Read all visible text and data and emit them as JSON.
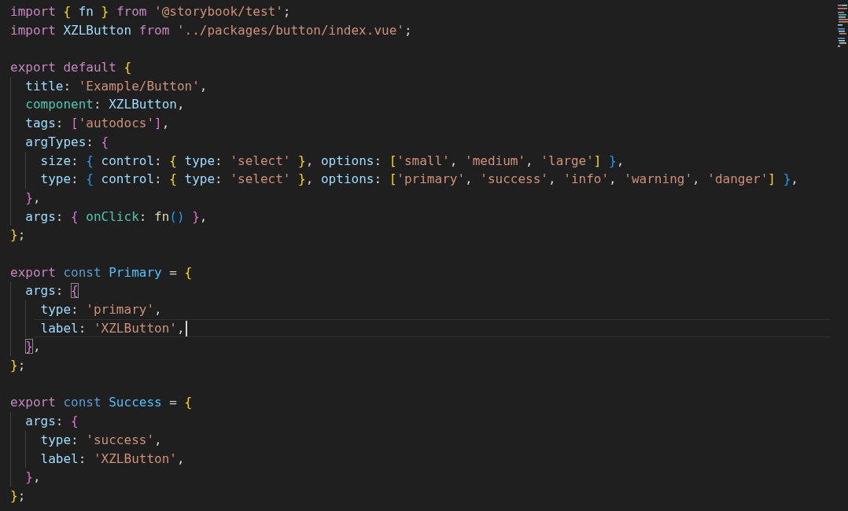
{
  "editor": {
    "lines": [
      {
        "kind": "code",
        "tokens": [
          {
            "kind": "kw",
            "text": "import "
          },
          {
            "kind": "b1",
            "text": "{"
          },
          {
            "kind": "var",
            "text": " fn "
          },
          {
            "kind": "b1",
            "text": "}"
          },
          {
            "kind": "kw",
            "text": " from"
          },
          {
            "kind": "str",
            "text": " '@storybook/test'"
          },
          {
            "kind": "p",
            "text": ";"
          }
        ]
      },
      {
        "kind": "code",
        "tokens": [
          {
            "kind": "kw",
            "text": "import"
          },
          {
            "kind": "var",
            "text": " XZLButton "
          },
          {
            "kind": "kw",
            "text": "from"
          },
          {
            "kind": "str",
            "text": " '../packages/button/index.vue'"
          },
          {
            "kind": "p",
            "text": ";"
          }
        ]
      },
      {
        "kind": "blank"
      },
      {
        "kind": "code",
        "tokens": [
          {
            "kind": "kw",
            "text": "export default "
          },
          {
            "kind": "b1",
            "text": "{"
          }
        ]
      },
      {
        "kind": "code",
        "tokens": [
          {
            "kind": "var",
            "text": "  title"
          },
          {
            "kind": "p",
            "text": ": "
          },
          {
            "kind": "str",
            "text": "'Example/Button'"
          },
          {
            "kind": "p",
            "text": ","
          }
        ]
      },
      {
        "kind": "code",
        "tokens": [
          {
            "kind": "member",
            "text": "  component"
          },
          {
            "kind": "p",
            "text": ": "
          },
          {
            "kind": "var",
            "text": "XZLButton"
          },
          {
            "kind": "p",
            "text": ","
          }
        ]
      },
      {
        "kind": "code",
        "tokens": [
          {
            "kind": "var",
            "text": "  tags"
          },
          {
            "kind": "p",
            "text": ": "
          },
          {
            "kind": "b2",
            "text": "["
          },
          {
            "kind": "str",
            "text": "'autodocs'"
          },
          {
            "kind": "b2",
            "text": "]"
          },
          {
            "kind": "p",
            "text": ","
          }
        ]
      },
      {
        "kind": "code",
        "tokens": [
          {
            "kind": "var",
            "text": "  argTypes"
          },
          {
            "kind": "p",
            "text": ": "
          },
          {
            "kind": "b2",
            "text": "{"
          }
        ]
      },
      {
        "kind": "code",
        "tokens": [
          {
            "kind": "var",
            "text": "    size"
          },
          {
            "kind": "p",
            "text": ": "
          },
          {
            "kind": "b3",
            "text": "{"
          },
          {
            "kind": "var",
            "text": " control"
          },
          {
            "kind": "p",
            "text": ": "
          },
          {
            "kind": "b1",
            "text": "{"
          },
          {
            "kind": "var",
            "text": " type"
          },
          {
            "kind": "p",
            "text": ": "
          },
          {
            "kind": "str",
            "text": "'select' "
          },
          {
            "kind": "b1",
            "text": "}"
          },
          {
            "kind": "p",
            "text": ", "
          },
          {
            "kind": "var",
            "text": "options"
          },
          {
            "kind": "p",
            "text": ": "
          },
          {
            "kind": "b1",
            "text": "["
          },
          {
            "kind": "str",
            "text": "'small'"
          },
          {
            "kind": "p",
            "text": ", "
          },
          {
            "kind": "str",
            "text": "'medium'"
          },
          {
            "kind": "p",
            "text": ", "
          },
          {
            "kind": "str",
            "text": "'large'"
          },
          {
            "kind": "b1",
            "text": "]"
          },
          {
            "kind": "b3",
            "text": " }"
          },
          {
            "kind": "p",
            "text": ","
          }
        ]
      },
      {
        "kind": "code",
        "tokens": [
          {
            "kind": "var",
            "text": "    type"
          },
          {
            "kind": "p",
            "text": ": "
          },
          {
            "kind": "b3",
            "text": "{"
          },
          {
            "kind": "var",
            "text": " control"
          },
          {
            "kind": "p",
            "text": ": "
          },
          {
            "kind": "b1",
            "text": "{"
          },
          {
            "kind": "var",
            "text": " type"
          },
          {
            "kind": "p",
            "text": ": "
          },
          {
            "kind": "str",
            "text": "'select' "
          },
          {
            "kind": "b1",
            "text": "}"
          },
          {
            "kind": "p",
            "text": ", "
          },
          {
            "kind": "var",
            "text": "options"
          },
          {
            "kind": "p",
            "text": ": "
          },
          {
            "kind": "b1",
            "text": "["
          },
          {
            "kind": "str",
            "text": "'primary'"
          },
          {
            "kind": "p",
            "text": ", "
          },
          {
            "kind": "str",
            "text": "'success'"
          },
          {
            "kind": "p",
            "text": ", "
          },
          {
            "kind": "str",
            "text": "'info'"
          },
          {
            "kind": "p",
            "text": ", "
          },
          {
            "kind": "str",
            "text": "'warning'"
          },
          {
            "kind": "p",
            "text": ", "
          },
          {
            "kind": "str",
            "text": "'danger'"
          },
          {
            "kind": "b1",
            "text": "]"
          },
          {
            "kind": "b3",
            "text": " }"
          },
          {
            "kind": "p",
            "text": ","
          }
        ]
      },
      {
        "kind": "code",
        "tokens": [
          {
            "kind": "b2",
            "text": "  }"
          },
          {
            "kind": "p",
            "text": ","
          }
        ]
      },
      {
        "kind": "code",
        "tokens": [
          {
            "kind": "var",
            "text": "  args"
          },
          {
            "kind": "p",
            "text": ": "
          },
          {
            "kind": "b2",
            "text": "{"
          },
          {
            "kind": "member",
            "text": " onClick"
          },
          {
            "kind": "p",
            "text": ": "
          },
          {
            "kind": "fn",
            "text": "fn"
          },
          {
            "kind": "b3",
            "text": "()"
          },
          {
            "kind": "b2",
            "text": " }"
          },
          {
            "kind": "p",
            "text": ","
          }
        ]
      },
      {
        "kind": "code",
        "tokens": [
          {
            "kind": "b1",
            "text": "}"
          },
          {
            "kind": "p",
            "text": ";"
          }
        ]
      },
      {
        "kind": "blank"
      },
      {
        "kind": "code",
        "tokens": [
          {
            "kind": "kw",
            "text": "export "
          },
          {
            "kind": "storage",
            "text": "const "
          },
          {
            "kind": "cls",
            "text": "Primary"
          },
          {
            "kind": "p",
            "text": " = "
          },
          {
            "kind": "b1",
            "text": "{"
          }
        ]
      },
      {
        "kind": "code",
        "tokens": [
          {
            "kind": "var",
            "text": "  args"
          },
          {
            "kind": "p",
            "text": ": "
          },
          {
            "kind": "b2",
            "text": "{",
            "matched": true
          }
        ]
      },
      {
        "kind": "code",
        "tokens": [
          {
            "kind": "var",
            "text": "    type"
          },
          {
            "kind": "p",
            "text": ": "
          },
          {
            "kind": "str",
            "text": "'primary'"
          },
          {
            "kind": "p",
            "text": ","
          }
        ]
      },
      {
        "kind": "code",
        "cursor": true,
        "tokens": [
          {
            "kind": "var",
            "text": "    label"
          },
          {
            "kind": "p",
            "text": ": "
          },
          {
            "kind": "str",
            "text": "'XZLButton'"
          },
          {
            "kind": "p",
            "text": ","
          }
        ]
      },
      {
        "kind": "code",
        "tokens": [
          {
            "kind": "b2",
            "text": "  }",
            "matched": true
          },
          {
            "kind": "p",
            "text": ","
          }
        ]
      },
      {
        "kind": "code",
        "tokens": [
          {
            "kind": "b1",
            "text": "}"
          },
          {
            "kind": "p",
            "text": ";"
          }
        ]
      },
      {
        "kind": "blank"
      },
      {
        "kind": "code",
        "tokens": [
          {
            "kind": "kw",
            "text": "export "
          },
          {
            "kind": "storage",
            "text": "const "
          },
          {
            "kind": "cls",
            "text": "Success"
          },
          {
            "kind": "p",
            "text": " = "
          },
          {
            "kind": "b1",
            "text": "{"
          }
        ]
      },
      {
        "kind": "code",
        "tokens": [
          {
            "kind": "var",
            "text": "  args"
          },
          {
            "kind": "p",
            "text": ": "
          },
          {
            "kind": "b2",
            "text": "{"
          }
        ]
      },
      {
        "kind": "code",
        "tokens": [
          {
            "kind": "var",
            "text": "    type"
          },
          {
            "kind": "p",
            "text": ": "
          },
          {
            "kind": "str",
            "text": "'success'"
          },
          {
            "kind": "p",
            "text": ","
          }
        ]
      },
      {
        "kind": "code",
        "tokens": [
          {
            "kind": "var",
            "text": "    label"
          },
          {
            "kind": "p",
            "text": ": "
          },
          {
            "kind": "str",
            "text": "'XZLButton'"
          },
          {
            "kind": "p",
            "text": ","
          }
        ]
      },
      {
        "kind": "code",
        "tokens": [
          {
            "kind": "b2",
            "text": "  }"
          },
          {
            "kind": "p",
            "text": ","
          }
        ]
      },
      {
        "kind": "code",
        "tokens": [
          {
            "kind": "b1",
            "text": "}"
          },
          {
            "kind": "p",
            "text": ";"
          }
        ]
      }
    ]
  }
}
